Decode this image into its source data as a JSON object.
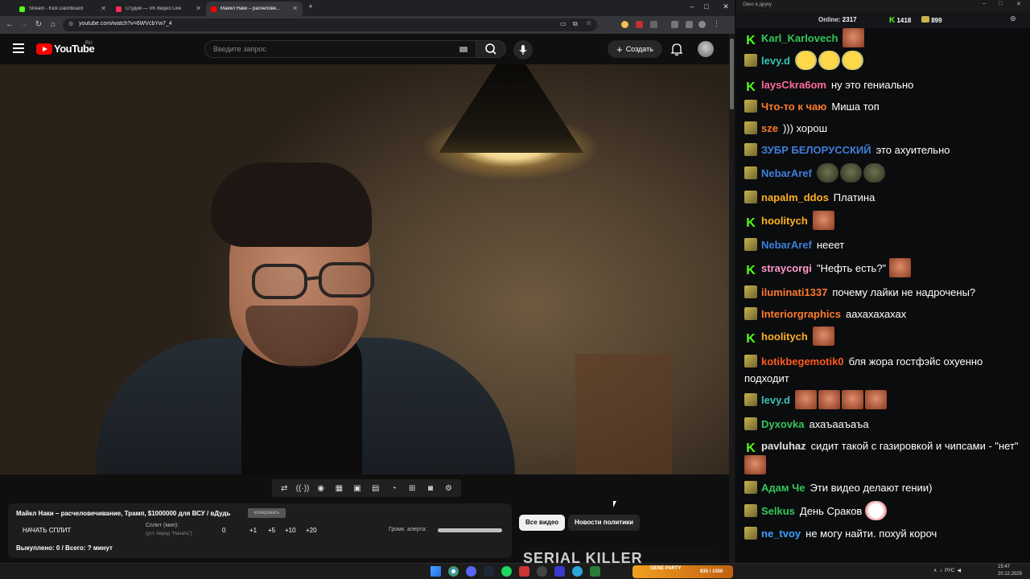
{
  "browser": {
    "tabs": [
      {
        "title": "Stream - Kick Dashboard",
        "color": "#53fc18",
        "active": false
      },
      {
        "title": "Студия — VK Видео Live",
        "color": "#ff2d55",
        "active": false
      },
      {
        "title": "Майкл Наки – расчелове...",
        "color": "#ff0000",
        "active": true
      }
    ],
    "url": "youtube.com/watch?v=6WVcbYw7_4"
  },
  "youtube": {
    "logo_text": "YouTube",
    "region": "RU",
    "search_placeholder": "Введите запрос",
    "create_label": "Создать",
    "create_icon": "plus-icon"
  },
  "split": {
    "title": "Майкл Наки – расчеловечивание, Трамп, $1000000 для ВСУ / вДудь",
    "copy_label": "копировать",
    "start_label": "НАЧАТЬ СПЛИТ",
    "min_label": "Сплит (мин):",
    "min_hint": "(уст. перед \"Начать\")",
    "minutes_value": "0",
    "increments": [
      "+1",
      "+5",
      "+10",
      "+20"
    ],
    "volume_label": "Громк. алерта:",
    "volume_level": 1.0,
    "bought": "Выкуплено: 0 / Всего: ? минут"
  },
  "chips": {
    "all": "Все видео",
    "news": "Новости политики"
  },
  "thumbnail_text": "SERIAL KILLER",
  "chat": {
    "window_title": "Окно в друку",
    "online_label": "Online:",
    "online_count": "2317",
    "kick_count": "1418",
    "vk_count": "899",
    "messages": [
      {
        "platform": "kick",
        "nick": "Karl_Karlovech",
        "color": "#34c759",
        "text": "",
        "emotes": [
          "face"
        ]
      },
      {
        "platform": "vk",
        "nick": "levy.d",
        "color": "#3cc2b5",
        "text": "",
        "emotes": [
          "laugh",
          "laugh",
          "laugh"
        ]
      },
      {
        "platform": "kick",
        "nick": "laysCkra6om",
        "color": "#ff6b9a",
        "text": "ну это гениально",
        "emotes": []
      },
      {
        "platform": "vk",
        "nick": "Что-то к чаю",
        "color": "#ff7a2e",
        "text": "Миша топ",
        "emotes": []
      },
      {
        "platform": "vk",
        "nick": "sze",
        "color": "#ff7a2e",
        "text": "))) хорош",
        "emotes": []
      },
      {
        "platform": "vk",
        "nick": "ЗУБР БЕЛОРУССКИЙ",
        "color": "#3f7fd9",
        "text": "это ахуительно",
        "emotes": []
      },
      {
        "platform": "vk",
        "nick": "NebarAref",
        "color": "#3f7fd9",
        "text": "",
        "emotes": [
          "frog",
          "frog",
          "frog"
        ]
      },
      {
        "platform": "vk",
        "nick": "napalm_ddos",
        "color": "#ffb020",
        "text": "Платина",
        "emotes": []
      },
      {
        "platform": "kick",
        "nick": "hoolitych",
        "color": "#ffb020",
        "text": "",
        "emotes": [
          "face"
        ]
      },
      {
        "platform": "vk",
        "nick": "NebarAref",
        "color": "#3f7fd9",
        "text": "нееет",
        "emotes": []
      },
      {
        "platform": "kick",
        "nick": "straycorgi",
        "color": "#ff9acb",
        "text": "\"Нефть есть?\"",
        "emotes": [
          "face"
        ]
      },
      {
        "platform": "vk",
        "nick": "iluminati1337",
        "color": "#ff7a2e",
        "text": "почему лайки не надрочены?",
        "emotes": []
      },
      {
        "platform": "vk",
        "nick": "Interiorgraphics",
        "color": "#ff7a2e",
        "text": "аахахахахах",
        "emotes": []
      },
      {
        "platform": "kick",
        "nick": "hoolitych",
        "color": "#ffb020",
        "text": "",
        "emotes": [
          "face"
        ]
      },
      {
        "platform": "vk",
        "nick": "kotikbegemotik0",
        "color": "#ff5a1f",
        "text": "бля жора гостфэйс охуенно подходит",
        "emotes": []
      },
      {
        "platform": "vk",
        "nick": "levy.d",
        "color": "#3cc2b5",
        "text": "",
        "emotes": [
          "face",
          "face",
          "face",
          "face"
        ]
      },
      {
        "platform": "vk",
        "nick": "Dyxovka",
        "color": "#34c759",
        "text": "ахаъааъаъа",
        "emotes": []
      },
      {
        "platform": "kick",
        "nick": "pavluhaz",
        "color": "#e0e0e0",
        "text": "сидит такой с газировкой и чипсами - \"нет\"",
        "emotes": [
          "face"
        ]
      },
      {
        "platform": "vk",
        "nick": "Адам Че",
        "color": "#34c759",
        "text": "Эти видео делают гении)",
        "emotes": []
      },
      {
        "platform": "vk",
        "nick": "Selkus",
        "color": "#34c759",
        "text": "День Сраков",
        "emotes": [
          "clown"
        ]
      },
      {
        "platform": "vk",
        "nick": "ne_tvoy",
        "color": "#3aa0ff",
        "text": "не могу найти. похуй короч",
        "emotes": []
      }
    ]
  },
  "taskbar": {
    "widget_name": "GENE PARTY",
    "widget_count": "835 / 1500",
    "lang": "РУС",
    "time": "15:47",
    "date": "20.12.2025"
  }
}
